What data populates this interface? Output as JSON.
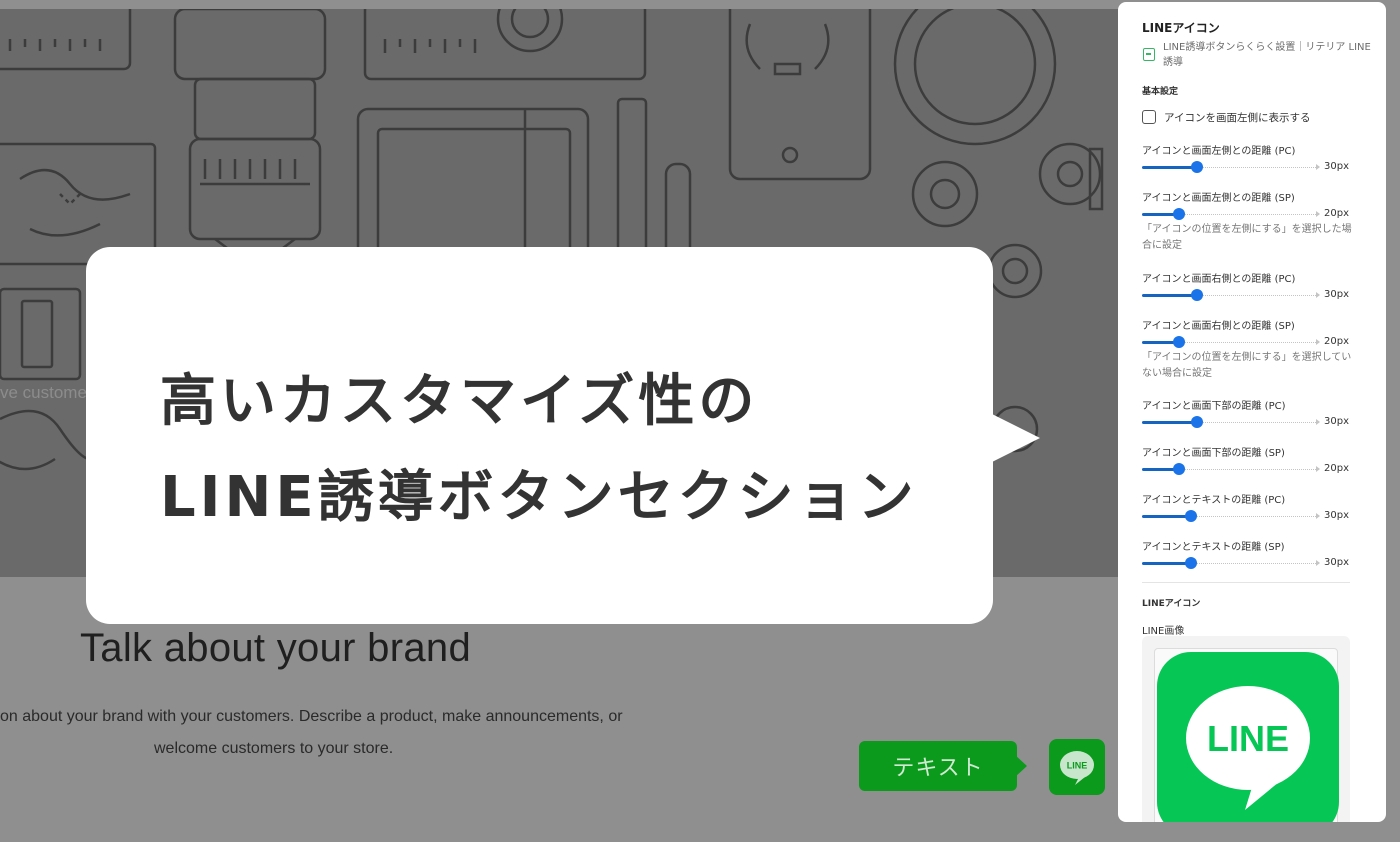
{
  "background": {
    "hero_cut_text": "ve custome",
    "heading": "Talk about your brand",
    "body_line_1": "on about your brand with your customers. Describe a product, make announcements, or",
    "body_line_2": "welcome customers to your store.",
    "text_button_label": "テキスト",
    "line_badge_text": "LINE"
  },
  "callout": {
    "line_1": "高いカスタマイズ性の",
    "line_2": "LINE誘導ボタンセクション"
  },
  "panel": {
    "title": "LINEアイコン",
    "app_name": "LINE誘導ボタンらくらく設置｜リテリア LINE誘導",
    "section_basic": "基本設定",
    "checkbox_label": "アイコンを画面左側に表示する",
    "checkbox_checked": false,
    "sliders": [
      {
        "label": "アイコンと画面左側との距離 (PC)",
        "value": "30px",
        "fill": 0.31
      },
      {
        "label": "アイコンと画面左側との距離 (SP)",
        "value": "20px",
        "fill": 0.21,
        "help": "「アイコンの位置を左側にする」を選択した場合に設定"
      },
      {
        "label": "アイコンと画面右側との距離 (PC)",
        "value": "30px",
        "fill": 0.31
      },
      {
        "label": "アイコンと画面右側との距離 (SP)",
        "value": "20px",
        "fill": 0.21,
        "help": "「アイコンの位置を左側にする」を選択していない場合に設定"
      },
      {
        "label": "アイコンと画面下部の距離 (PC)",
        "value": "30px",
        "fill": 0.31
      },
      {
        "label": "アイコンと画面下部の距離 (SP)",
        "value": "20px",
        "fill": 0.21
      },
      {
        "label": "アイコンとテキストの距離 (PC)",
        "value": "30px",
        "fill": 0.28
      },
      {
        "label": "アイコンとテキストの距離 (SP)",
        "value": "30px",
        "fill": 0.28
      }
    ],
    "section_line": "LINEアイコン",
    "line_image_label": "LINE画像",
    "line_logo_text": "LINE"
  },
  "colors": {
    "line_green": "#06c755",
    "dim_green": "#0b9a1b",
    "slider_blue": "#1a73e8"
  }
}
